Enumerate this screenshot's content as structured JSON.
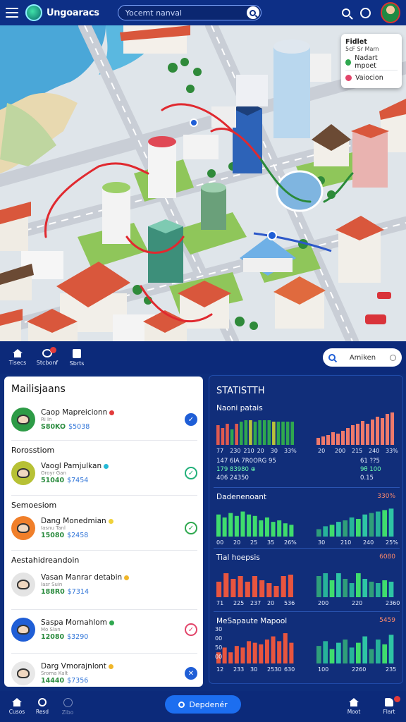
{
  "topbar": {
    "title": "Ungoaracs",
    "search_placeholder": "Yocemt nanval",
    "icons": [
      "menu-icon",
      "app-logo",
      "search-icon",
      "globe-icon",
      "user-avatar"
    ]
  },
  "map": {
    "legend": {
      "title": "Fidlet",
      "subtitle": "5cF Sr Marn",
      "items": [
        {
          "label": "Nadart mpoet",
          "color": "#2fa84f"
        },
        {
          "label": "Vaiocion",
          "color": "#e2456a"
        }
      ]
    }
  },
  "navband": {
    "tabs": [
      {
        "label": "Tisecs",
        "icon": "home-icon"
      },
      {
        "label": "Stcbonf",
        "icon": "share-icon"
      },
      {
        "label": "Sbrts",
        "icon": "document-icon"
      }
    ],
    "search_label": "Amiken"
  },
  "list": {
    "title": "Mailisjaans",
    "sections": [
      {
        "label": "",
        "items": [
          {
            "name": "Caop Mapreicionn",
            "sub": "Ri In",
            "num_a": "S80KO",
            "num_b": "$5038",
            "av_color": "#2d9b46",
            "tag_color": "#e23b3b",
            "status_color": "#1f5ed6",
            "status_filled": true,
            "status_glyph": "✓"
          }
        ]
      },
      {
        "label": "Rorosstiom",
        "items": [
          {
            "name": "Vaogl Pamjulkan",
            "sub": "Oroyr Gan",
            "num_a": "51040",
            "num_b": "$7454",
            "av_color": "#b7c135",
            "tag_color": "#25b9d6",
            "status_color": "#22b07a",
            "status_filled": false,
            "status_glyph": "✓"
          }
        ]
      },
      {
        "label": "Semoesiom",
        "items": [
          {
            "name": "Dang Monedmian",
            "sub": "Iasnu Tanl",
            "num_a": "15080",
            "num_b": "$2458",
            "av_color": "#f07f2a",
            "tag_color": "#f0d23a",
            "status_color": "#2fa84f",
            "status_filled": false,
            "status_glyph": "✓"
          }
        ]
      },
      {
        "label": "Aestahidreandoin",
        "items": [
          {
            "name": "Vasan Manrar detabin",
            "sub": "Iasr Suin",
            "num_a": "188R0",
            "num_b": "$7314",
            "av_color": "#e4e4e4",
            "tag_color": "#f0b62a",
            "status_color": "#ffffff",
            "status_filled": false,
            "status_glyph": ""
          },
          {
            "name": "Saspa Mornahlom",
            "sub": "Mo Slan",
            "num_a": "12080",
            "num_b": "$3290",
            "av_color": "#1f5ed6",
            "tag_color": "#2fa84f",
            "status_color": "#e2456a",
            "status_filled": false,
            "status_glyph": "✓"
          },
          {
            "name": "Darg Vmorajnlont",
            "sub": "Sroma Kalt",
            "num_a": "14440",
            "num_b": "$7356",
            "av_color": "#e8e8e8",
            "tag_color": "#f0b62a",
            "status_color": "#1f5ed6",
            "status_filled": true,
            "status_glyph": "✕"
          }
        ]
      }
    ]
  },
  "stats": {
    "title": "STATISTTH",
    "blocks": [
      {
        "label": "Naoni patais",
        "value": "",
        "rows": [
          {
            "text": "147  6IA 7R0ORG 95",
            "right": "61 ??5",
            "style": "mixed"
          },
          {
            "text": "179  83980 ⊕",
            "right": "9θ 100",
            "style": "green"
          },
          {
            "text": "406  24350",
            "right": "0.15",
            "style": "mixed"
          }
        ],
        "left_ticks": [
          "77",
          "230",
          "210",
          "20",
          "30",
          "33%"
        ],
        "right_ticks": [
          "20",
          "200",
          "215",
          "240",
          "33%"
        ]
      },
      {
        "label": "Dadenenoant",
        "value": "330%",
        "left_ticks": [
          "00",
          "20",
          "25",
          "35",
          "26%"
        ],
        "right_ticks": [
          "30",
          "210",
          "240",
          "25%"
        ]
      },
      {
        "label": "Tial hoepsis",
        "value": "6080",
        "left_ticks": [
          "71",
          "225",
          "237",
          "20",
          "536"
        ],
        "right_ticks": [
          "200",
          "220",
          "2360"
        ]
      },
      {
        "label": "MeSapaute Mapool",
        "value": "5459",
        "left_ticks": [
          "12",
          "233",
          "30",
          "2530",
          "630"
        ],
        "right_ticks": [
          "100",
          "2260",
          "235"
        ],
        "y_ticks": [
          "30",
          "00",
          "50",
          "00"
        ]
      }
    ]
  },
  "bottombar": {
    "left": [
      {
        "label": "Cusos",
        "icon": "home-icon",
        "dim": false
      },
      {
        "label": "Resd",
        "icon": "search-icon",
        "dim": false
      },
      {
        "label": "Zibo",
        "icon": "face-icon",
        "dim": true
      }
    ],
    "primary_button": "Depdenér",
    "right": [
      {
        "label": "Moot",
        "icon": "home-icon"
      },
      {
        "label": "Flart",
        "icon": "flag-icon"
      }
    ]
  },
  "chart_data": [
    {
      "type": "bar",
      "title": "Naoni patais",
      "series": [
        {
          "name": "",
          "values": [
            28,
            24,
            30,
            22,
            30,
            33,
            35,
            35,
            33,
            35,
            35,
            35,
            33,
            33,
            33,
            33,
            33
          ]
        },
        {
          "name": "",
          "values": [
            10,
            12,
            14,
            18,
            16,
            20,
            24,
            28,
            30,
            34,
            30,
            36,
            40,
            38,
            44,
            46
          ]
        }
      ]
    },
    {
      "type": "bar",
      "title": "Dadenenoant",
      "series": [
        {
          "name": "",
          "values": [
            30,
            26,
            32,
            28,
            34,
            30,
            28,
            22,
            26,
            20,
            22,
            18,
            16
          ]
        },
        {
          "name": "",
          "values": [
            10,
            14,
            16,
            20,
            22,
            26,
            24,
            30,
            32,
            34,
            36,
            38
          ]
        }
      ]
    },
    {
      "type": "bar",
      "title": "Tial hoepsis",
      "series": [
        {
          "name": "",
          "values": [
            22,
            34,
            26,
            30,
            22,
            30,
            24,
            20,
            16,
            30,
            32
          ]
        },
        {
          "name": "",
          "values": [
            30,
            34,
            24,
            34,
            26,
            20,
            34,
            26,
            22,
            20,
            24,
            22
          ]
        }
      ]
    },
    {
      "type": "bar",
      "title": "MeSapaute Mapool",
      "series": [
        {
          "name": "",
          "values": [
            14,
            20,
            14,
            22,
            20,
            28,
            26,
            24,
            30,
            34,
            28,
            38,
            26
          ]
        },
        {
          "name": "",
          "values": [
            22,
            28,
            18,
            26,
            30,
            20,
            26,
            34,
            18,
            30,
            24,
            36
          ]
        }
      ]
    }
  ]
}
